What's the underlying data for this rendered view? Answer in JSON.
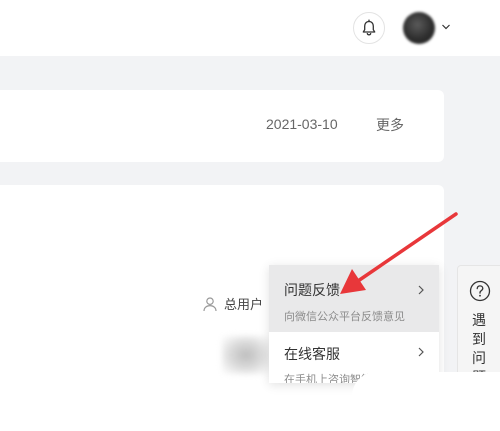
{
  "card1": {
    "date": "2021-03-10",
    "more_label": "更多"
  },
  "card2": {
    "users_label": "总用户"
  },
  "menu": {
    "items": [
      {
        "title": "问题反馈",
        "subtitle": "向微信公众平台反馈意见"
      },
      {
        "title": "在线客服",
        "subtitle": "在手机上咨询智能客服"
      }
    ]
  },
  "side_panel": {
    "chars": [
      "遇",
      "到",
      "问",
      "题"
    ]
  },
  "icons": {
    "bell": "bell-icon",
    "chevron": "chevron-down-icon",
    "user": "user-icon",
    "help": "question-circle-icon"
  },
  "colors": {
    "annotation_arrow": "#e8373a"
  }
}
